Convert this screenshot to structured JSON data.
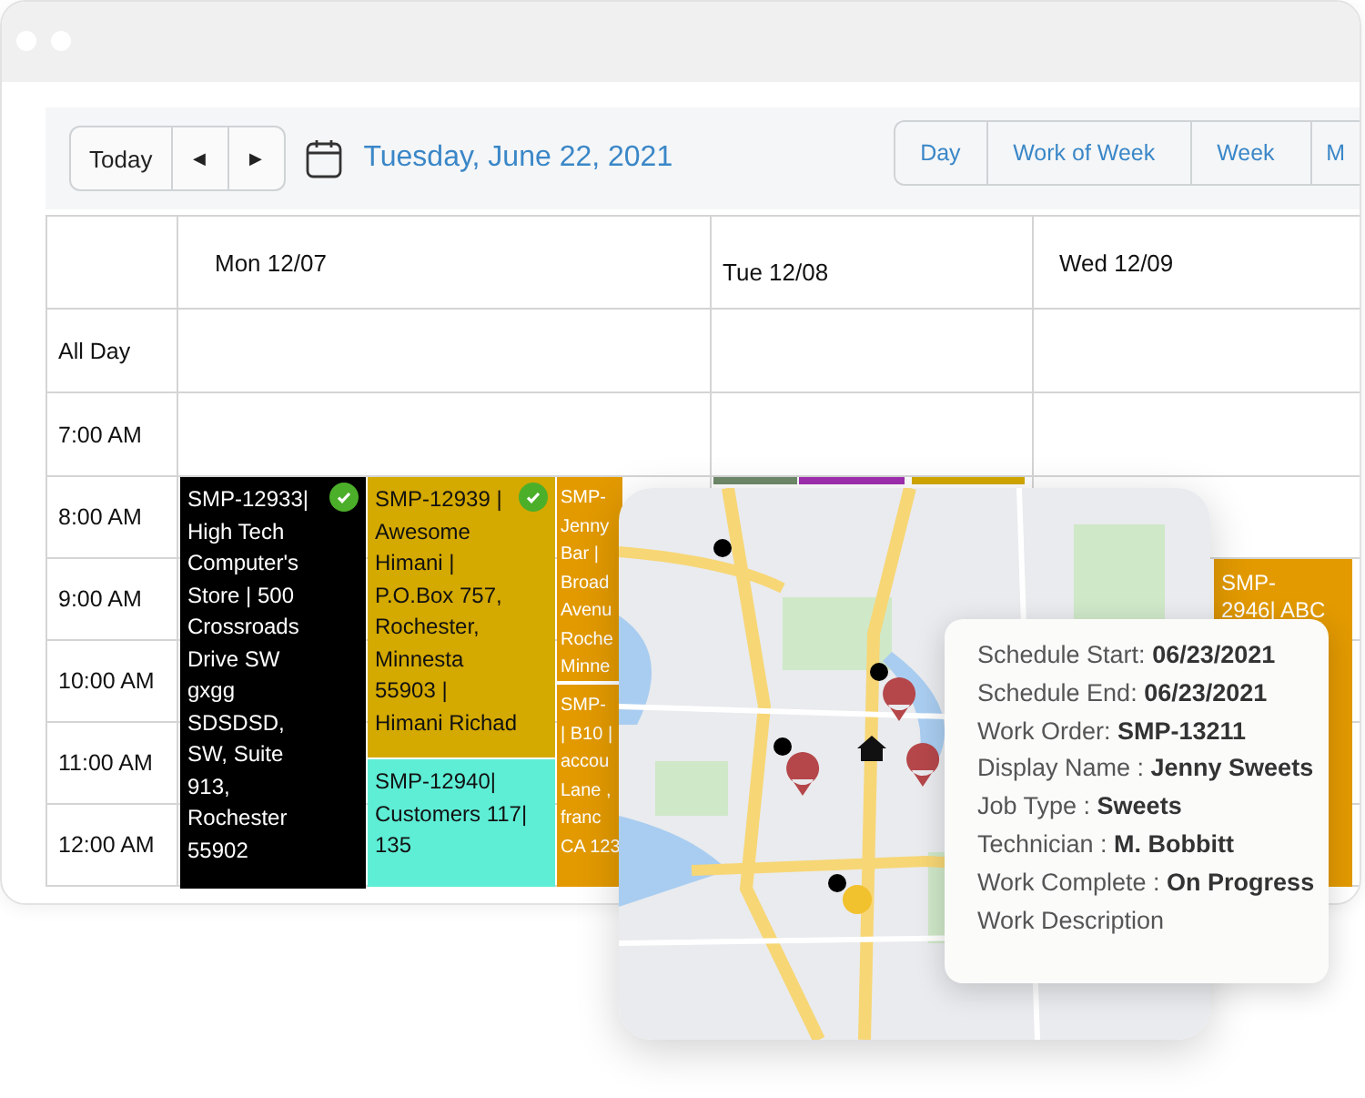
{
  "toolbar": {
    "today": "Today",
    "prev": "◀",
    "next": "▶",
    "date": "Tuesday, June 22, 2021",
    "views": [
      {
        "label": "Day",
        "selected": false
      },
      {
        "label": "Work of Week",
        "selected": false
      },
      {
        "label": "Week",
        "selected": false
      },
      {
        "label": "M",
        "selected": false
      }
    ]
  },
  "calendar": {
    "days": [
      "Mon 12/07",
      "Tue 12/08",
      "Wed 12/09"
    ],
    "times": [
      "All Day",
      "7:00 AM",
      "8:00 AM",
      "9:00 AM",
      "10:00 AM",
      "11:00 AM",
      "12:00 AM"
    ],
    "events": [
      {
        "text": "SMP-12933| High Tech Computer's Store | 500 Crossroads Drive SW gxgg SDSDSD, SW, Suite 913, Rochester 55902",
        "color": "#000000",
        "checked": true
      },
      {
        "text": "SMP-12939 | Awesome Himani | P.O.Box 757, Rochester, Minnesta 55903 | Himani Richad",
        "color": "#d4a900",
        "checked": true
      },
      {
        "text": "SMP-12940| Customers 117| 135",
        "color": "#5eeed6",
        "checked": false
      },
      {
        "text": "SMP-\nJenny\nBar |\nBroad\nAvenu\nRoche\nMinne",
        "color": "#e39a00",
        "checked": false
      },
      {
        "text": "SMP-\n| B10 |\naccou\nLane ,\nfranc\nCA 123",
        "color": "#e39a00",
        "checked": false
      },
      {
        "color": "#6f8a6a",
        "checked": false
      },
      {
        "color": "#a02fb0",
        "checked": false
      },
      {
        "color": "#d4a900",
        "checked": false
      },
      {
        "text": "SMP-\n2946| ABC",
        "color": "#e39a00",
        "checked": false
      }
    ]
  },
  "tooltip": {
    "fields": [
      "Schedule Start: **06/23/2021**",
      "Schedule End: **06/23/2021**",
      "Work Order: **SMP-13211**",
      "Display Name : **Jenny Sweets**",
      "Job Type : **Sweets**",
      "Technician : **M. Bobbitt**",
      "Work Complete :  **On Progress**",
      "Work Description"
    ]
  }
}
